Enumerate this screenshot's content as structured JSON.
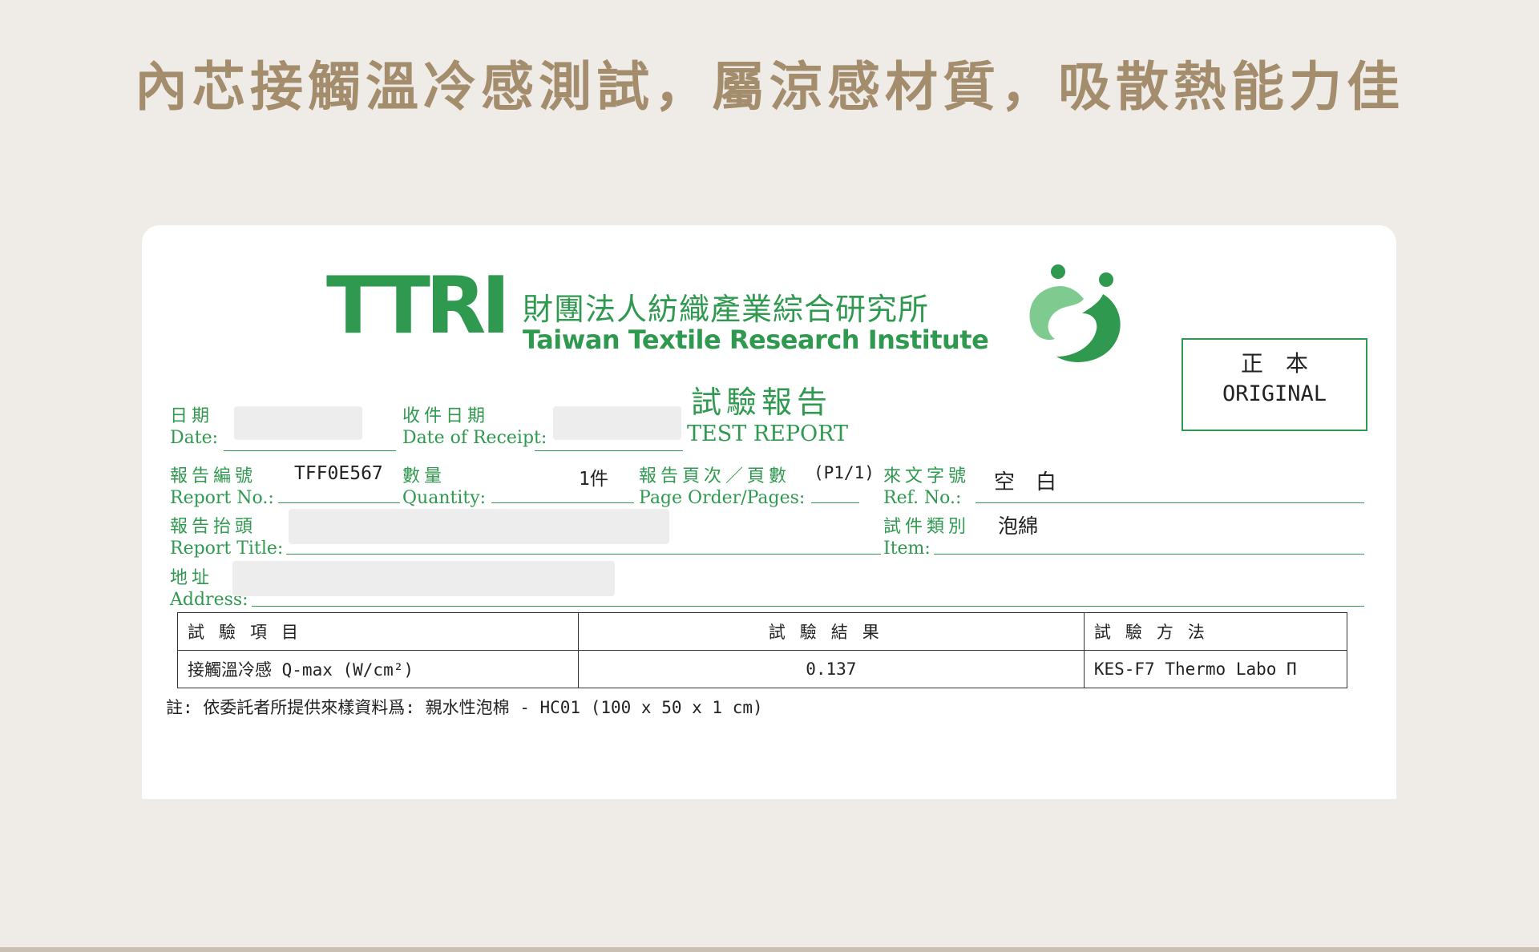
{
  "headline": "內芯接觸溫冷感測試，屬涼感材質，吸散熱能力佳",
  "logo": {
    "mark": "TTRI",
    "org_zh": "財團法人紡織產業綜合研究所",
    "org_en": "Taiwan Textile Research Institute"
  },
  "stamp": {
    "zh": "正本",
    "en": "ORIGINAL"
  },
  "report_title": {
    "zh": "試驗報告",
    "en": "TEST REPORT"
  },
  "fields": {
    "date": {
      "zh": "日期",
      "en": "Date:"
    },
    "receipt": {
      "zh": "收件日期",
      "en": "Date of Receipt:"
    },
    "report_no": {
      "zh": "報告編號",
      "en": "Report No.:",
      "value": "TFF0E567"
    },
    "quantity": {
      "zh": "數量",
      "en": "Quantity:",
      "value": "1件"
    },
    "pages": {
      "zh": "報告頁次／頁數",
      "en": "Page Order/Pages:",
      "value": "(P1/1)"
    },
    "ref_no": {
      "zh": "來文字號",
      "en": "Ref. No.:",
      "value": "空　白"
    },
    "title": {
      "zh": "報告抬頭",
      "en": "Report Title:"
    },
    "item": {
      "zh": "試件類別",
      "en": "Item:",
      "value": "泡綿"
    },
    "address": {
      "zh": "地址",
      "en": "Address:"
    }
  },
  "table": {
    "headers": [
      "試驗項目",
      "試驗結果",
      "試驗方法"
    ],
    "rows": [
      {
        "item": "接觸溫冷感 Q-max (W/cm²)",
        "result": "0.137",
        "method": "KES-F7 Thermo Labo Π"
      }
    ]
  },
  "note": "註: 依委託者所提供來樣資料爲: 親水性泡棉 - HC01 (100 x 50 x 1 cm)",
  "colors": {
    "brand_green": "#2f9a4f",
    "headline": "#a38d6d",
    "background": "#efece8"
  }
}
